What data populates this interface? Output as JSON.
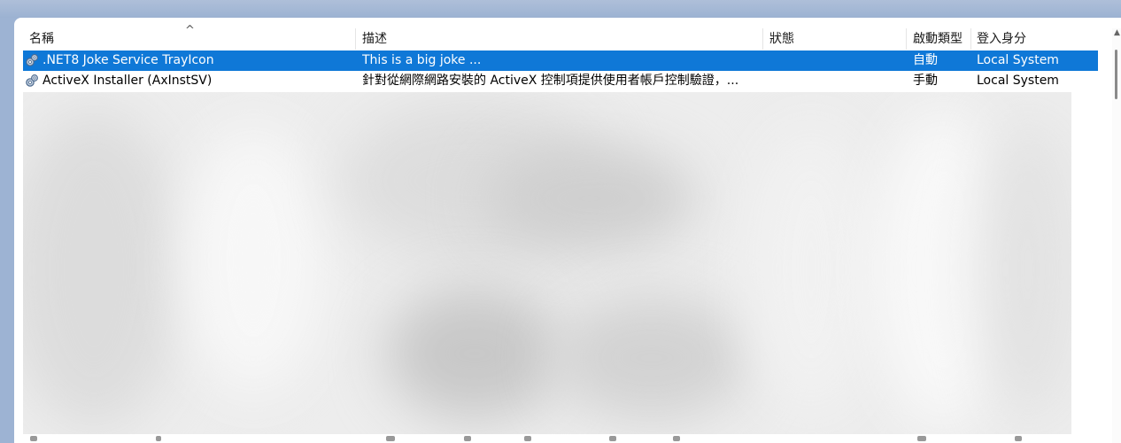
{
  "columns": {
    "name": "名稱",
    "description": "描述",
    "status": "狀態",
    "startup_type": "啟動類型",
    "log_on_as": "登入身分"
  },
  "sort_indicator": "^",
  "services": [
    {
      "name": ".NET8 Joke Service TrayIcon",
      "description": "This is a big joke ...",
      "status": "",
      "startup_type": "自動",
      "log_on_as": "Local System",
      "selected": true,
      "icon": "gear-icon"
    },
    {
      "name": "ActiveX Installer (AxInstSV)",
      "description": "針對從網際網路安裝的 ActiveX 控制項提供使用者帳戶控制驗證，...",
      "status": "",
      "startup_type": "手動",
      "log_on_as": "Local System",
      "selected": false,
      "icon": "gear-icon"
    }
  ],
  "colors": {
    "selection": "#0f78d7",
    "background_band": "#9db3d3"
  }
}
